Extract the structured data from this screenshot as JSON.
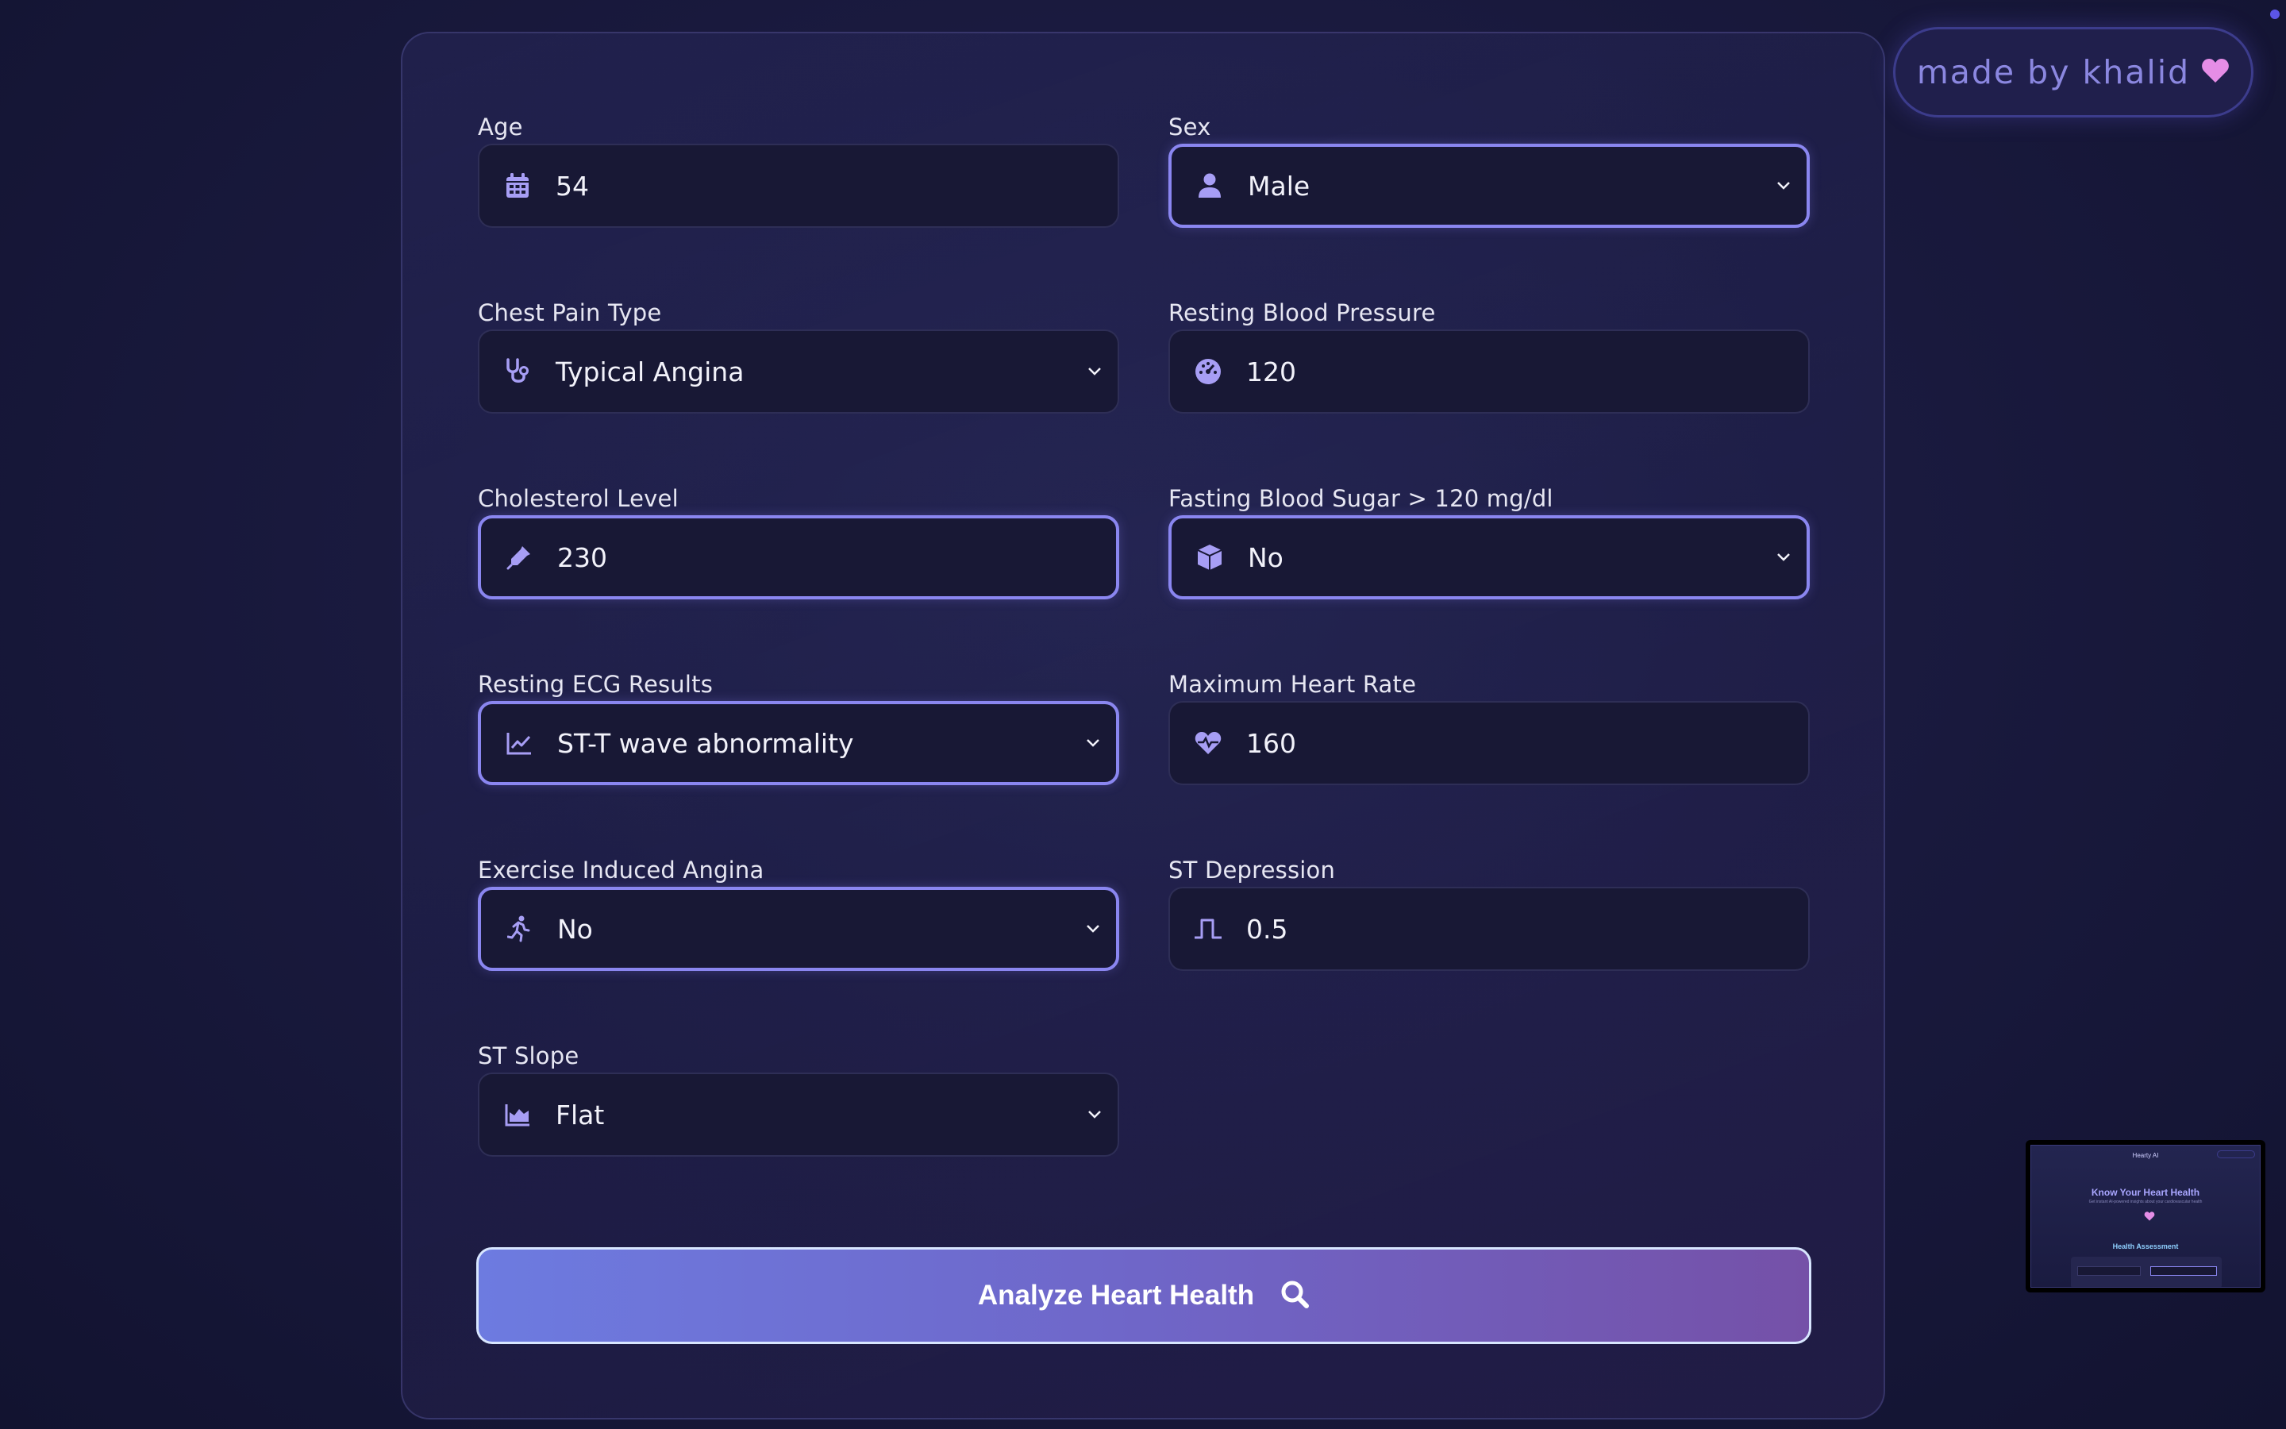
{
  "form": {
    "fields": [
      {
        "label": "Age",
        "value": "54",
        "icon": "calendar-icon",
        "type": "input"
      },
      {
        "label": "Sex",
        "value": "Male",
        "icon": "user-icon",
        "type": "select"
      },
      {
        "label": "Chest Pain Type",
        "value": "Typical Angina",
        "icon": "stethoscope-icon",
        "type": "select"
      },
      {
        "label": "Resting Blood Pressure",
        "value": "120",
        "icon": "gauge-icon",
        "type": "input"
      },
      {
        "label": "Cholesterol Level",
        "value": "230",
        "icon": "syringe-icon",
        "type": "input"
      },
      {
        "label": "Fasting Blood Sugar > 120 mg/dl",
        "value": "No",
        "icon": "cube-icon",
        "type": "select"
      },
      {
        "label": "Resting ECG Results",
        "value": "ST-T wave abnormality",
        "icon": "line-chart-icon",
        "type": "select"
      },
      {
        "label": "Maximum Heart Rate",
        "value": "160",
        "icon": "heart-pulse-icon",
        "type": "input"
      },
      {
        "label": "Exercise Induced Angina",
        "value": "No",
        "icon": "running-icon",
        "type": "select"
      },
      {
        "label": "ST Depression",
        "value": "0.5",
        "icon": "step-wave-icon",
        "type": "input"
      },
      {
        "label": "ST Slope",
        "value": "Flat",
        "icon": "area-chart-icon",
        "type": "select"
      }
    ],
    "submit_label": "Analyze Heart Health"
  },
  "badge": {
    "text": "made by khalid"
  },
  "thumbnail": {
    "brand": "Hearty AI",
    "heading": "Know Your Heart Health",
    "subheading": "Get instant AI-powered insights about your cardiovascular health",
    "section": "Health Assessment"
  },
  "colors": {
    "accent": "#8a86f0",
    "icon": "#a79ef5",
    "button_start": "#6d7be0",
    "button_end": "#7551a8",
    "badge_text": "#8b87e0",
    "heart": "#e58de6"
  }
}
